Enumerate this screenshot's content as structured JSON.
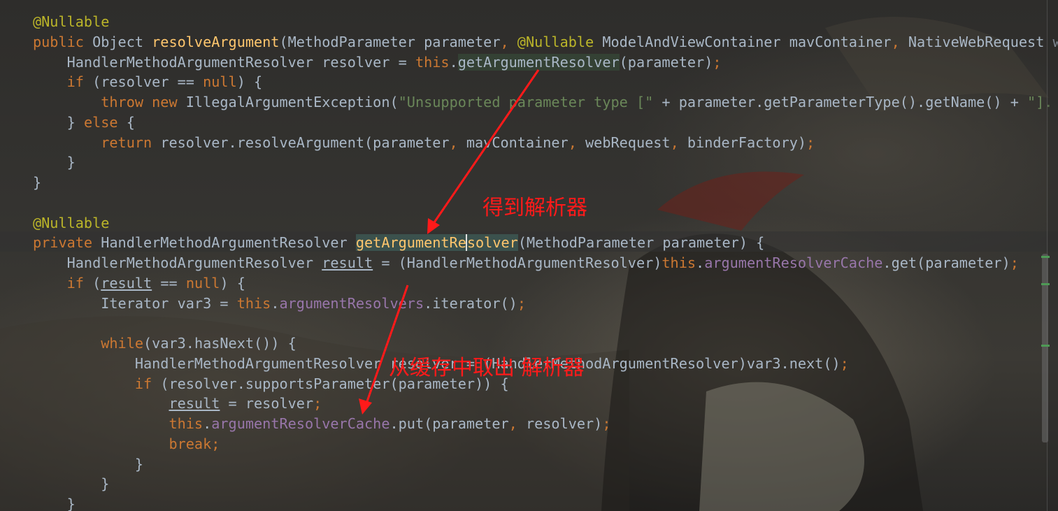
{
  "editor": {
    "lines": [
      [
        {
          "t": "@Nullable",
          "c": "ann"
        }
      ],
      [
        {
          "t": "public ",
          "c": "kw"
        },
        {
          "t": "Object "
        },
        {
          "t": "resolveArgument",
          "c": "fn"
        },
        {
          "t": "(MethodParameter parameter"
        },
        {
          "t": ", ",
          "c": "kw"
        },
        {
          "t": "@Nullable ",
          "c": "ann"
        },
        {
          "t": "ModelAndViewContainer mavContainer"
        },
        {
          "t": ", ",
          "c": "kw"
        },
        {
          "t": "NativeWebRequest we"
        }
      ],
      [
        {
          "t": "    HandlerMethodArgumentResolver resolver = "
        },
        {
          "t": "this",
          "c": "kw"
        },
        {
          "t": "."
        },
        {
          "t": "getArgumentResolver",
          "c": "usage"
        },
        {
          "t": "(parameter)"
        },
        {
          "t": ";",
          "c": "kw"
        }
      ],
      [
        {
          "t": "    "
        },
        {
          "t": "if ",
          "c": "kw"
        },
        {
          "t": "(resolver == "
        },
        {
          "t": "null",
          "c": "kw"
        },
        {
          "t": ") {"
        }
      ],
      [
        {
          "t": "        "
        },
        {
          "t": "throw new ",
          "c": "kw"
        },
        {
          "t": "IllegalArgumentException("
        },
        {
          "t": "\"Unsupported parameter type [\"",
          "c": "str"
        },
        {
          "t": " + parameter.getParameterType().getName() + "
        },
        {
          "t": "\"].",
          "c": "str"
        }
      ],
      [
        {
          "t": "    } "
        },
        {
          "t": "else ",
          "c": "kw"
        },
        {
          "t": "{"
        }
      ],
      [
        {
          "t": "        "
        },
        {
          "t": "return ",
          "c": "kw"
        },
        {
          "t": "resolver.resolveArgument(parameter"
        },
        {
          "t": ", ",
          "c": "kw"
        },
        {
          "t": "mavContainer"
        },
        {
          "t": ", ",
          "c": "kw"
        },
        {
          "t": "webRequest"
        },
        {
          "t": ", ",
          "c": "kw"
        },
        {
          "t": "binderFactory)"
        },
        {
          "t": ";",
          "c": "kw"
        }
      ],
      [
        {
          "t": "    }"
        }
      ],
      [
        {
          "t": "}"
        }
      ],
      [
        {
          "t": ""
        }
      ],
      [
        {
          "t": "@Nullable",
          "c": "ann"
        }
      ],
      [
        {
          "t": "private ",
          "c": "kw"
        },
        {
          "t": "HandlerMethodArgumentResolver "
        },
        {
          "t": "getArgumentRe",
          "c": "fn match"
        },
        {
          "t": "solver",
          "c": "fn match caret"
        },
        {
          "t": "(MethodParameter parameter) {"
        }
      ],
      [
        {
          "t": "    HandlerMethodArgumentResolver "
        },
        {
          "t": "result",
          "c": "und"
        },
        {
          "t": " = (HandlerMethodArgumentResolver)"
        },
        {
          "t": "this",
          "c": "kw"
        },
        {
          "t": "."
        },
        {
          "t": "argumentResolverCache",
          "c": "fld"
        },
        {
          "t": ".get(parameter)"
        },
        {
          "t": ";",
          "c": "kw"
        }
      ],
      [
        {
          "t": "    "
        },
        {
          "t": "if ",
          "c": "kw"
        },
        {
          "t": "("
        },
        {
          "t": "result",
          "c": "und"
        },
        {
          "t": " == "
        },
        {
          "t": "null",
          "c": "kw"
        },
        {
          "t": ") {"
        }
      ],
      [
        {
          "t": "        Iterator var3 = "
        },
        {
          "t": "this",
          "c": "kw"
        },
        {
          "t": "."
        },
        {
          "t": "argumentResolvers",
          "c": "fld"
        },
        {
          "t": ".iterator()"
        },
        {
          "t": ";",
          "c": "kw"
        }
      ],
      [
        {
          "t": ""
        }
      ],
      [
        {
          "t": "        "
        },
        {
          "t": "while",
          "c": "kw"
        },
        {
          "t": "(var3.hasNext()) {"
        }
      ],
      [
        {
          "t": "            HandlerMethodArgumentResolver resolver = (HandlerMethodArgumentResolver)var3.next()"
        },
        {
          "t": ";",
          "c": "kw"
        }
      ],
      [
        {
          "t": "            "
        },
        {
          "t": "if ",
          "c": "kw"
        },
        {
          "t": "(resolver.supportsParameter(parameter)) {"
        }
      ],
      [
        {
          "t": "                "
        },
        {
          "t": "result",
          "c": "und"
        },
        {
          "t": " = resolver"
        },
        {
          "t": ";",
          "c": "kw"
        }
      ],
      [
        {
          "t": "                "
        },
        {
          "t": "this",
          "c": "kw"
        },
        {
          "t": "."
        },
        {
          "t": "argumentResolverCache",
          "c": "fld"
        },
        {
          "t": ".put(parameter"
        },
        {
          "t": ", ",
          "c": "kw"
        },
        {
          "t": "resolver)"
        },
        {
          "t": ";",
          "c": "kw"
        }
      ],
      [
        {
          "t": "                "
        },
        {
          "t": "break;",
          "c": "kw"
        }
      ],
      [
        {
          "t": "            }"
        }
      ],
      [
        {
          "t": "        }"
        }
      ],
      [
        {
          "t": "    }"
        }
      ]
    ]
  },
  "annotations": {
    "note1": "得到解析器",
    "note2": "从缓存中取出 解析器",
    "color": "#ff1a1a"
  },
  "theme": {
    "keyword": "#cc7832",
    "annotation": "#bbb529",
    "method_decl": "#ffc66d",
    "string": "#6a8759",
    "field": "#9876aa",
    "default_text": "#a9b7c6"
  }
}
